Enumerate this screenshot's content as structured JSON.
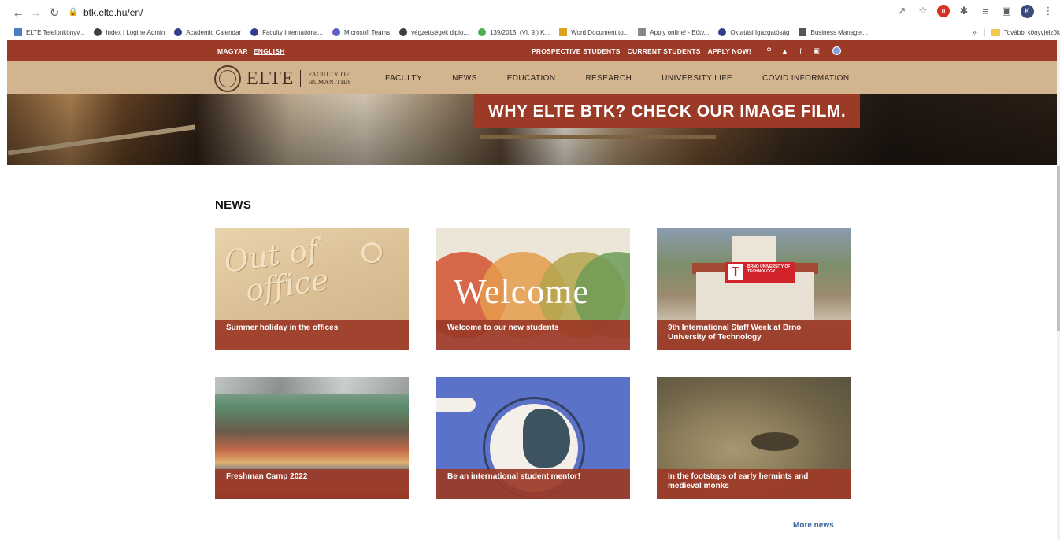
{
  "browser": {
    "url": "btk.elte.hu/en/",
    "bookmarks": [
      "ELTE Telefonkönyv...",
      "Index | LoginetAdmin",
      "Academic Calendar",
      "Faculty Internationa...",
      "Microsoft Teams",
      "végzettségek diplo...",
      "139/2015. (VI. 9.) K...",
      "Word Document to...",
      "Apply online! - Eötv...",
      "Oktatási Igazgatóság",
      "Business Manager..."
    ],
    "more_bookmarks": "»",
    "other_bookmarks": "További könyvjelzők",
    "profile_initial": "K"
  },
  "site": {
    "lang": {
      "hu": "MAGYAR",
      "en": "ENGLISH"
    },
    "top_links": [
      "PROSPECTIVE STUDENTS",
      "CURRENT STUDENTS",
      "APPLY NOW!"
    ],
    "logo": {
      "wordmark": "ELTE",
      "faculty_line1": "FACULTY OF",
      "faculty_line2": "HUMANITIES"
    },
    "menu": [
      "FACULTY",
      "NEWS",
      "EDUCATION",
      "RESEARCH",
      "UNIVERSITY LIFE",
      "COVID INFORMATION"
    ],
    "hero_caption": "WHY ELTE BTK? CHECK OUR IMAGE FILM.",
    "news_heading": "NEWS",
    "news": [
      {
        "title": "Summer holiday in the offices",
        "image_text_1": "Out of",
        "image_text_2": "office"
      },
      {
        "title": "Welcome to our new students",
        "image_text": "Welcome"
      },
      {
        "title": "9th International Staff Week at Brno University of Technology",
        "sign_letter": "T",
        "sign_text": "BRNO UNIVERSITY OF TECHNOLOGY"
      },
      {
        "title": "Freshman Camp 2022"
      },
      {
        "title": "Be an international student mentor!"
      },
      {
        "title": "In the footsteps of early hermints and medieval monks"
      }
    ],
    "more_news": "More news"
  },
  "colors": {
    "brand_red": "#9c3a28",
    "brand_tan": "#d2b48f",
    "link_blue": "#3d6aa3"
  }
}
